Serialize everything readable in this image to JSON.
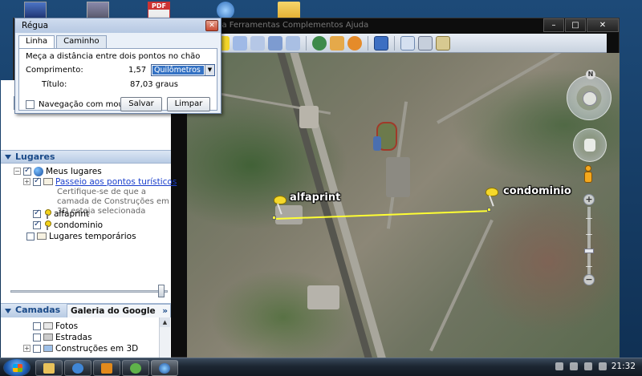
{
  "app": {
    "menu_ghost": "ada    Ferramentas    Complementos    Ajuda"
  },
  "window_controls": {
    "minimize": "–",
    "maximize": "□",
    "close": "✕"
  },
  "ruler": {
    "title": "Régua",
    "close_glyph": "✕",
    "tabs": [
      "Linha",
      "Caminho"
    ],
    "instruction": "Meça a distância entre dois pontos no chão",
    "length_label": "Comprimento:",
    "length_value": "1,57",
    "unit_selected": "Quilômetros",
    "heading_label": "Título:",
    "heading_value": "87,03 graus",
    "mouse_nav_label": "Navegação com mouse",
    "save_button": "Salvar",
    "clear_button": "Limpar"
  },
  "sidebar": {
    "places_header": "Lugares",
    "tree": {
      "my_places": "Meus lugares",
      "tour_link": "Passeio aos pontos turísticos",
      "tour_desc": "Certifique-se de que a camada de Construções em 3D esteja selecionada",
      "pin1": "alfaprint",
      "pin2": "condominio",
      "temp_places": "Lugares temporários"
    },
    "layers_tab": "Camadas",
    "gallery_tab": "Galeria do Google Earth",
    "gallery_chevron": "»",
    "layers": [
      "Fotos",
      "Estradas",
      "Construções em 3D"
    ]
  },
  "map": {
    "labels": {
      "pin_left": "alfaprint",
      "pin_right": "condominio"
    },
    "compass_n": "N",
    "zoom_plus": "+",
    "zoom_minus": "−"
  },
  "taskbar": {
    "clock": "21:32"
  },
  "colors": {
    "measure_line": "#ffff33",
    "pin": "#f5d82a",
    "selection": "#3472c4",
    "section_header_text": "#1a4a88"
  }
}
